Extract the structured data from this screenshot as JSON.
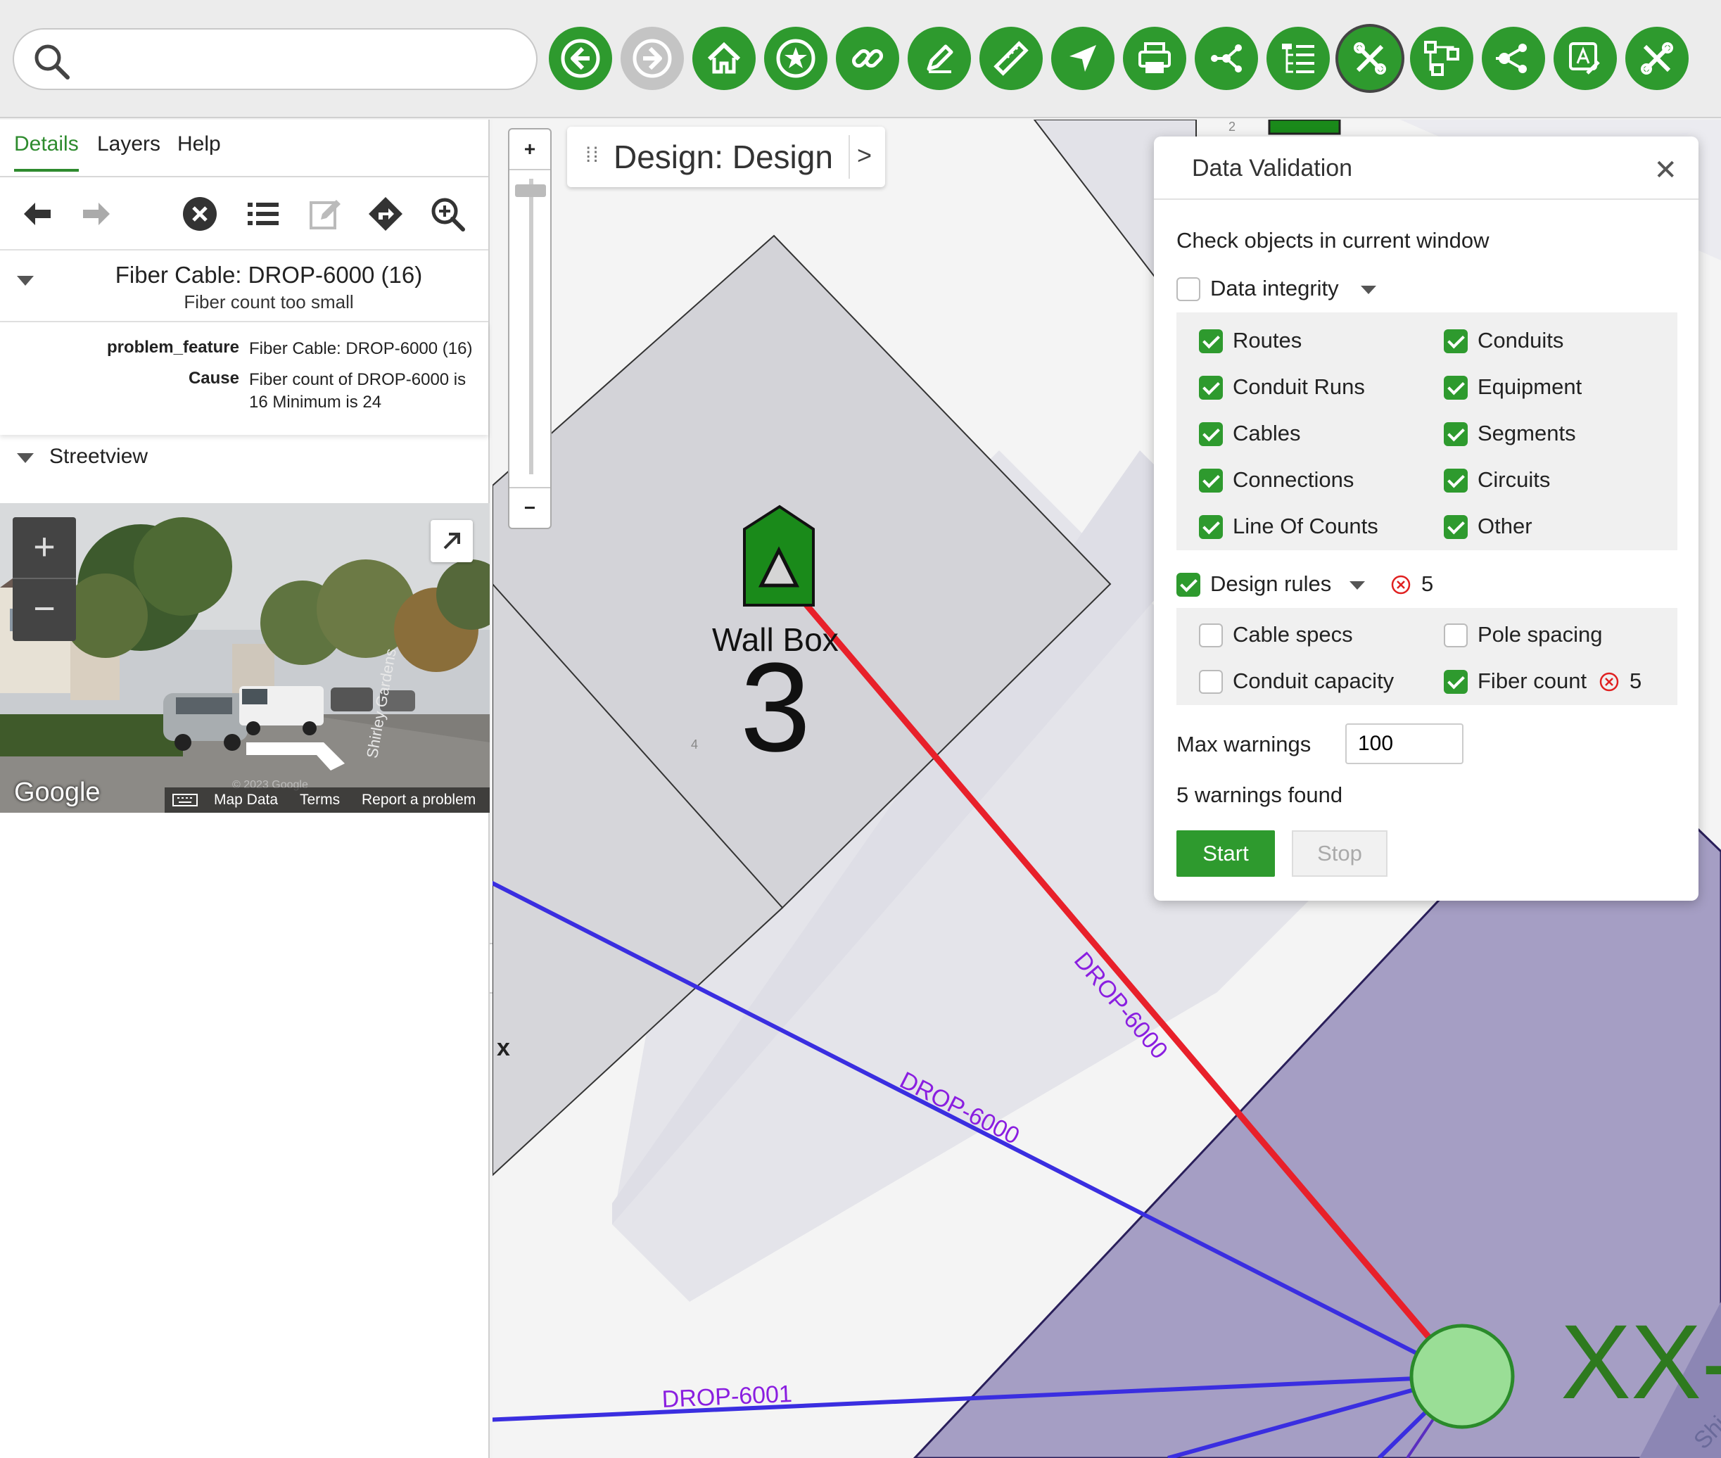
{
  "toolbar": {
    "search_placeholder": "",
    "buttons": [
      {
        "name": "back",
        "icon": "arrow-left-icon",
        "enabled": true
      },
      {
        "name": "forward",
        "icon": "arrow-right-icon",
        "enabled": false
      },
      {
        "name": "home",
        "icon": "home-icon",
        "enabled": true
      },
      {
        "name": "bookmarks",
        "icon": "star-icon",
        "enabled": true
      },
      {
        "name": "link",
        "icon": "link-icon",
        "enabled": true
      },
      {
        "name": "edit",
        "icon": "pencil-icon",
        "enabled": true
      },
      {
        "name": "measure",
        "icon": "ruler-icon",
        "enabled": true
      },
      {
        "name": "locate",
        "icon": "navigation-arrow-icon",
        "enabled": true
      },
      {
        "name": "print",
        "icon": "printer-icon",
        "enabled": true
      },
      {
        "name": "share",
        "icon": "share-icon",
        "enabled": true
      },
      {
        "name": "structure",
        "icon": "tree-list-icon",
        "enabled": true
      },
      {
        "name": "tools",
        "icon": "tools-icon",
        "enabled": true,
        "active": true
      },
      {
        "name": "network",
        "icon": "network-icon",
        "enabled": true
      },
      {
        "name": "connect",
        "icon": "plug-icon",
        "enabled": true
      },
      {
        "name": "annotate",
        "icon": "text-annotate-icon",
        "enabled": true
      },
      {
        "name": "tools-2",
        "icon": "tools-icon",
        "enabled": true
      }
    ],
    "accent": "#2e9a2e"
  },
  "left_panel": {
    "tabs": [
      "Details",
      "Layers",
      "Help"
    ],
    "active_tab": "Details",
    "feature_title": "Fiber Cable: DROP-6000 (16)",
    "feature_subtitle": "Fiber count too small",
    "properties": [
      {
        "key": "problem_feature",
        "value": "Fiber Cable: DROP-6000 (16)"
      },
      {
        "key": "Cause",
        "value": "Fiber count of DROP-6000 is 16 Minimum is 24"
      }
    ],
    "streetview_label": "Streetview",
    "streetview": {
      "logo": "Google",
      "keyboard": "keyboard-icon",
      "links": [
        "Map Data",
        "Terms",
        "Report a problem"
      ],
      "copyright": "© 2023 Google",
      "street_name": "Shirley Gardens"
    }
  },
  "map": {
    "design_label": "Design: Design",
    "zoom_in": "+",
    "zoom_out": "−",
    "wallbox_label": "Wall Box",
    "wallbox_number": "3",
    "tiny_labels": [
      "2",
      "4"
    ],
    "cable_labels": [
      "DROP-6000",
      "DROP-6000",
      "DROP-6001"
    ],
    "big_label": "XX-",
    "corner_text": "Shi",
    "edge_x": "x"
  },
  "data_validation": {
    "title": "Data Validation",
    "subtitle": "Check objects in current window",
    "data_integrity": {
      "label": "Data integrity",
      "checked": false
    },
    "integrity_items": [
      {
        "label": "Routes",
        "checked": true
      },
      {
        "label": "Conduits",
        "checked": true
      },
      {
        "label": "Conduit Runs",
        "checked": true
      },
      {
        "label": "Equipment",
        "checked": true
      },
      {
        "label": "Cables",
        "checked": true
      },
      {
        "label": "Segments",
        "checked": true
      },
      {
        "label": "Connections",
        "checked": true
      },
      {
        "label": "Circuits",
        "checked": true
      },
      {
        "label": "Line Of Counts",
        "checked": true
      },
      {
        "label": "Other",
        "checked": true
      }
    ],
    "design_rules": {
      "label": "Design rules",
      "checked": true,
      "error_count": "5"
    },
    "rule_items": [
      {
        "label": "Cable specs",
        "checked": false
      },
      {
        "label": "Pole spacing",
        "checked": false
      },
      {
        "label": "Conduit capacity",
        "checked": false
      },
      {
        "label": "Fiber count",
        "checked": true,
        "error_count": "5"
      }
    ],
    "max_warnings_label": "Max warnings",
    "max_warnings_value": "100",
    "warnings_found": "5 warnings found",
    "start_label": "Start",
    "stop_label": "Stop"
  }
}
